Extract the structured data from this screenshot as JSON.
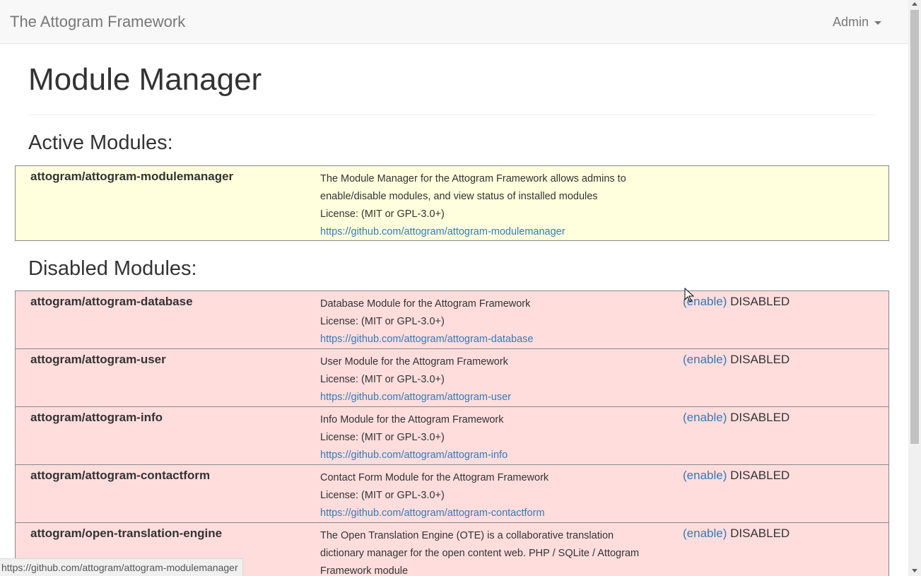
{
  "navbar": {
    "brand": "The Attogram Framework",
    "admin_label": "Admin"
  },
  "page": {
    "title": "Module Manager",
    "active_heading": "Active Modules:",
    "disabled_heading": "Disabled Modules:"
  },
  "active_modules": [
    {
      "name": "attogram/attogram-modulemanager",
      "description": "The Module Manager for the Attogram Framework allows admins to enable/disable modules, and view status of installed modules",
      "license": "License: (MIT or GPL-3.0+)",
      "url": "https://github.com/attogram/attogram-modulemanager"
    }
  ],
  "disabled_modules": [
    {
      "name": "attogram/attogram-database",
      "description": "Database Module for the Attogram Framework",
      "license": "License: (MIT or GPL-3.0+)",
      "url": "https://github.com/attogram/attogram-database",
      "enable_label": "(enable)",
      "status": "DISABLED"
    },
    {
      "name": "attogram/attogram-user",
      "description": "User Module for the Attogram Framework",
      "license": "License: (MIT or GPL-3.0+)",
      "url": "https://github.com/attogram/attogram-user",
      "enable_label": "(enable)",
      "status": "DISABLED"
    },
    {
      "name": "attogram/attogram-info",
      "description": "Info Module for the Attogram Framework",
      "license": "License: (MIT or GPL-3.0+)",
      "url": "https://github.com/attogram/attogram-info",
      "enable_label": "(enable)",
      "status": "DISABLED"
    },
    {
      "name": "attogram/attogram-contactform",
      "description": "Contact Form Module for the Attogram Framework",
      "license": "License: (MIT or GPL-3.0+)",
      "url": "https://github.com/attogram/attogram-contactform",
      "enable_label": "(enable)",
      "status": "DISABLED"
    },
    {
      "name": "attogram/open-translation-engine",
      "description": "The Open Translation Engine (OTE) is a collaborative translation dictionary manager for the open content web. PHP / SQLite / Attogram Framework module",
      "enable_label": "(enable)",
      "status": "DISABLED"
    }
  ],
  "browser": {
    "status_url": "https://github.com/attogram/attogram-modulemanager"
  },
  "colors": {
    "active_bg": "#ffffdd",
    "disabled_bg": "#ffdddd",
    "link": "#337ab7"
  }
}
